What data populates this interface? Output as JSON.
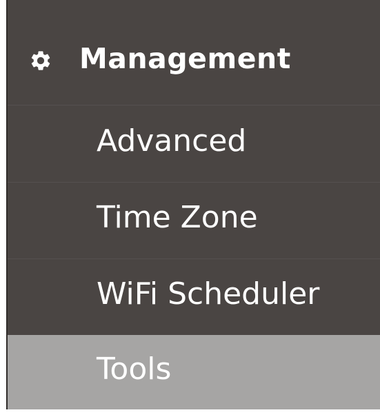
{
  "header": {
    "title": "Management",
    "icon": "gear-icon"
  },
  "menu": {
    "items": [
      {
        "label": "Advanced",
        "active": false
      },
      {
        "label": "Time Zone",
        "active": false
      },
      {
        "label": "WiFi Scheduler",
        "active": false
      },
      {
        "label": "Tools",
        "active": true
      }
    ]
  },
  "colors": {
    "panel_bg": "#4a4543",
    "active_bg": "#a6a5a4",
    "text": "#ffffff"
  }
}
